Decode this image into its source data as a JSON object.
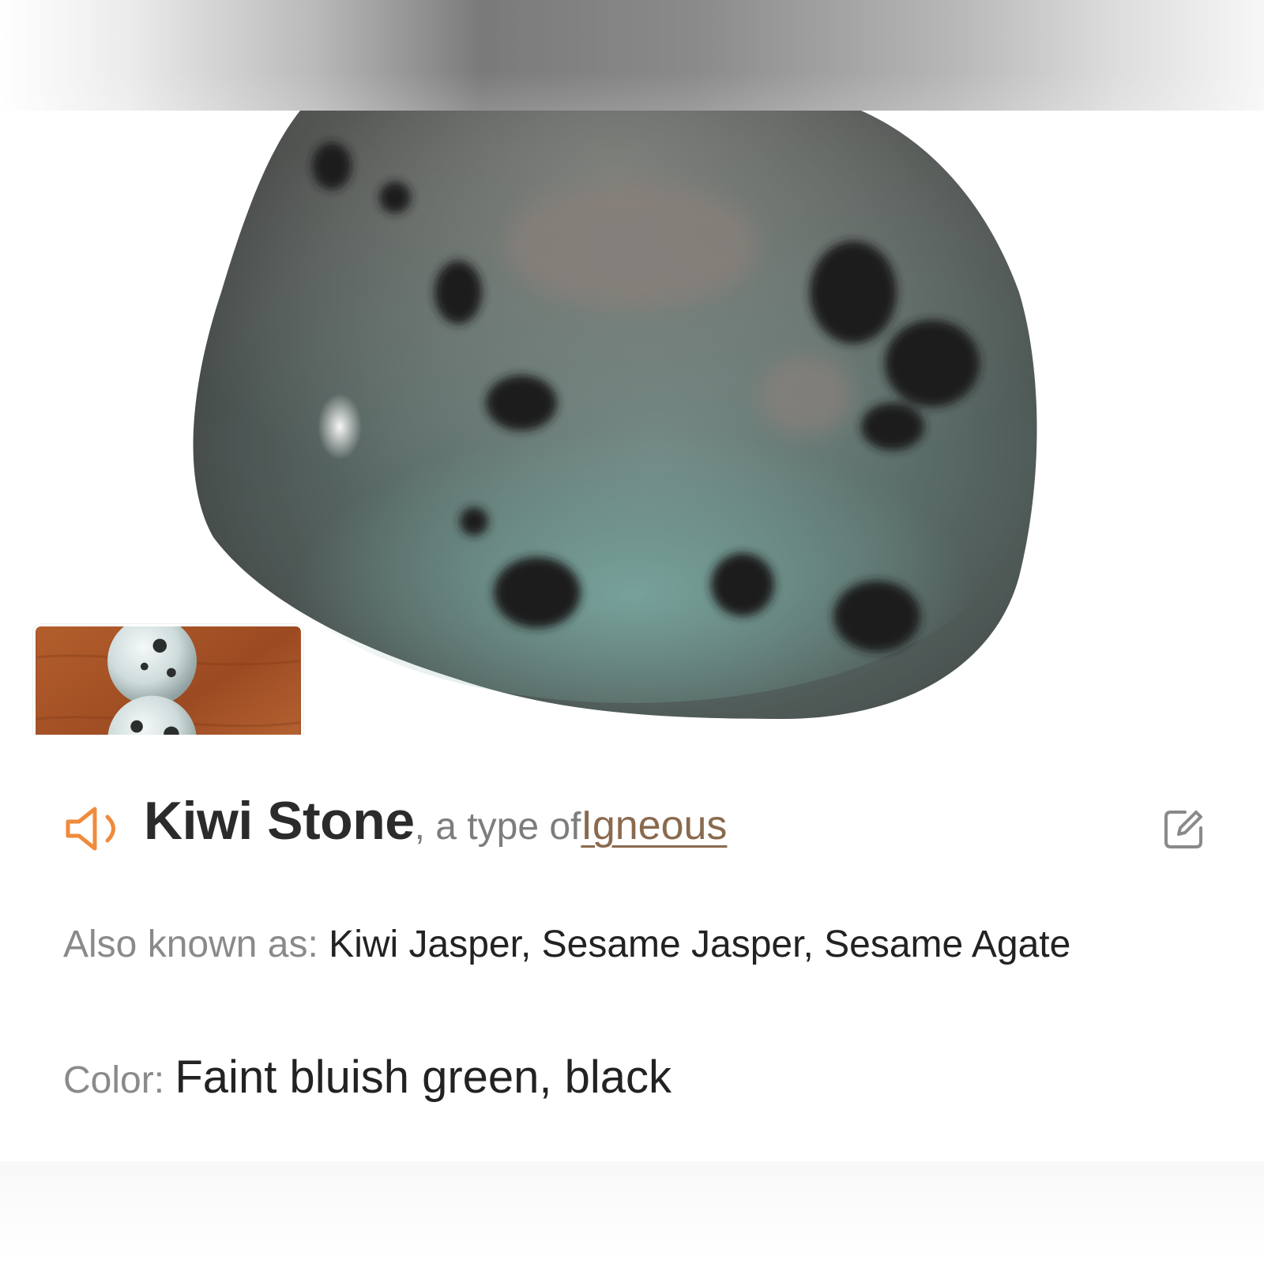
{
  "stone": {
    "name": "Kiwi Stone",
    "type_prefix": ", a type of ",
    "type_link": "Igneous"
  },
  "details": {
    "aka_label": "Also known as: ",
    "aka_value": "Kiwi Jasper, Sesame Jasper, Sesame Agate",
    "color_label": "Color: ",
    "color_value": "Faint bluish green, black"
  },
  "icons": {
    "speaker": "speaker-icon",
    "edit": "edit-icon"
  },
  "colors": {
    "accent_orange": "#f08a3c",
    "link_brown": "#8a6a4e",
    "label_gray": "#8a8a8a",
    "text_dark": "#222222"
  }
}
